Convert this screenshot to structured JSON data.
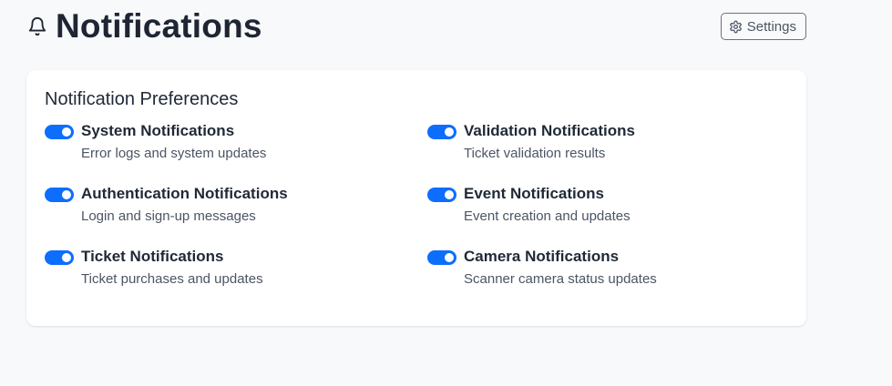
{
  "header": {
    "title": "Notifications",
    "bell_icon": "bell-icon",
    "settings_label": "Settings",
    "settings_icon": "gear-icon"
  },
  "preferences": {
    "title": "Notification Preferences",
    "accent_color": "#0d6efd",
    "items": [
      {
        "label": "System Notifications",
        "description": "Error logs and system updates",
        "enabled": true
      },
      {
        "label": "Validation Notifications",
        "description": "Ticket validation results",
        "enabled": true
      },
      {
        "label": "Authentication Notifications",
        "description": "Login and sign-up messages",
        "enabled": true
      },
      {
        "label": "Event Notifications",
        "description": "Event creation and updates",
        "enabled": true
      },
      {
        "label": "Ticket Notifications",
        "description": "Ticket purchases and updates",
        "enabled": true
      },
      {
        "label": "Camera Notifications",
        "description": "Scanner camera status updates",
        "enabled": true
      }
    ]
  }
}
